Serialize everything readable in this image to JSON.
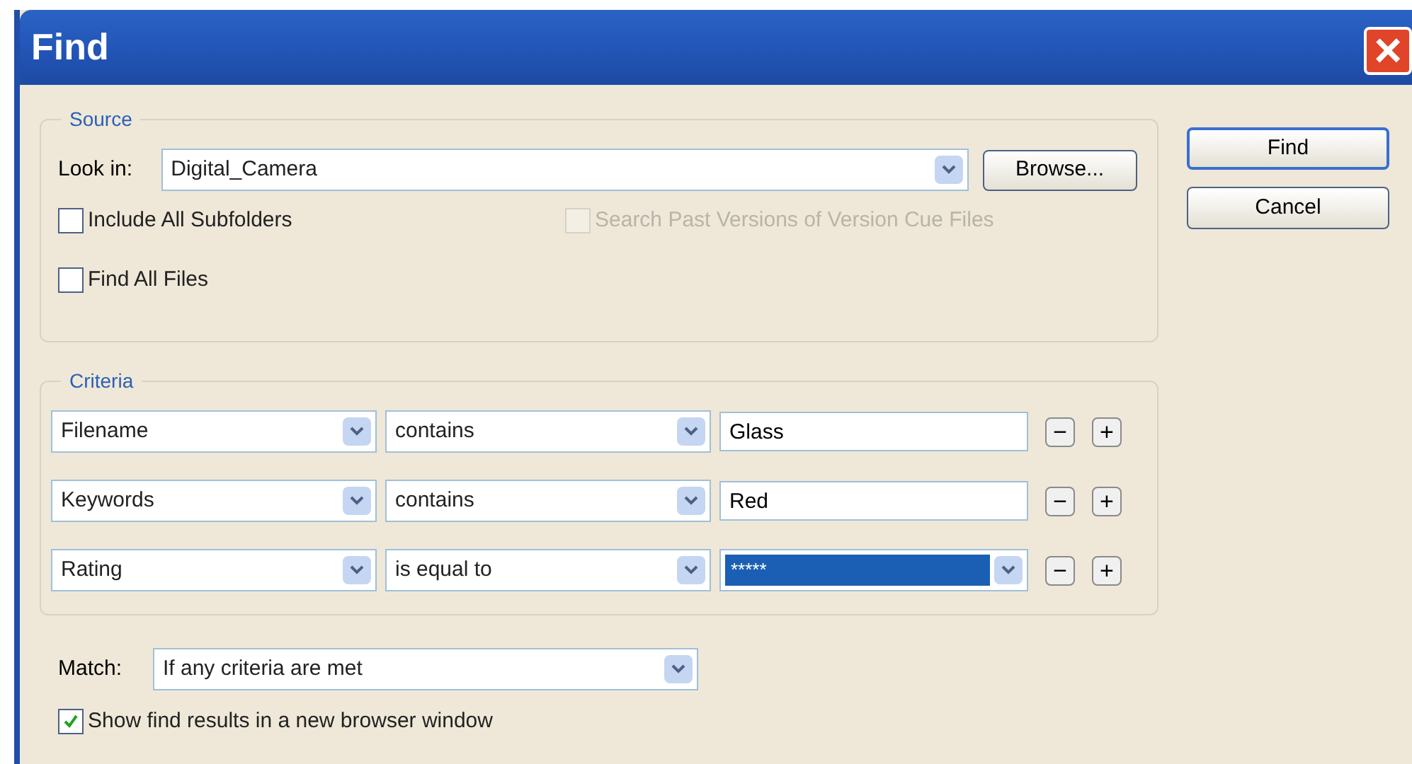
{
  "window": {
    "title": "Find",
    "close": "×"
  },
  "source": {
    "legend": "Source",
    "look_in": {
      "label": "Look in:",
      "value": "Digital_Camera"
    },
    "browse": "Browse...",
    "options": [
      {
        "label": "Include All Subfolders",
        "checked": false,
        "disabled": false
      },
      {
        "label": "Search Past Versions of Version Cue Files",
        "checked": false,
        "disabled": true
      },
      {
        "label": "Find All Files",
        "checked": false,
        "disabled": false
      }
    ]
  },
  "criteria": {
    "legend": "Criteria",
    "rows": [
      {
        "field": "Filename",
        "operator": "contains",
        "value": "Glass",
        "kind": "text"
      },
      {
        "field": "Keywords",
        "operator": "contains",
        "value": "Red",
        "kind": "text"
      },
      {
        "field": "Rating",
        "operator": "is equal to",
        "value": "*****",
        "kind": "select"
      }
    ],
    "remove": "−",
    "add": "+"
  },
  "match": {
    "label": "Match:",
    "value": "If any criteria are met"
  },
  "show_results": {
    "label": "Show find results in a new browser window",
    "checked": true,
    "disabled": false
  },
  "buttons": [
    {
      "label": "Find",
      "default": true
    },
    {
      "label": "Cancel",
      "default": false
    }
  ]
}
